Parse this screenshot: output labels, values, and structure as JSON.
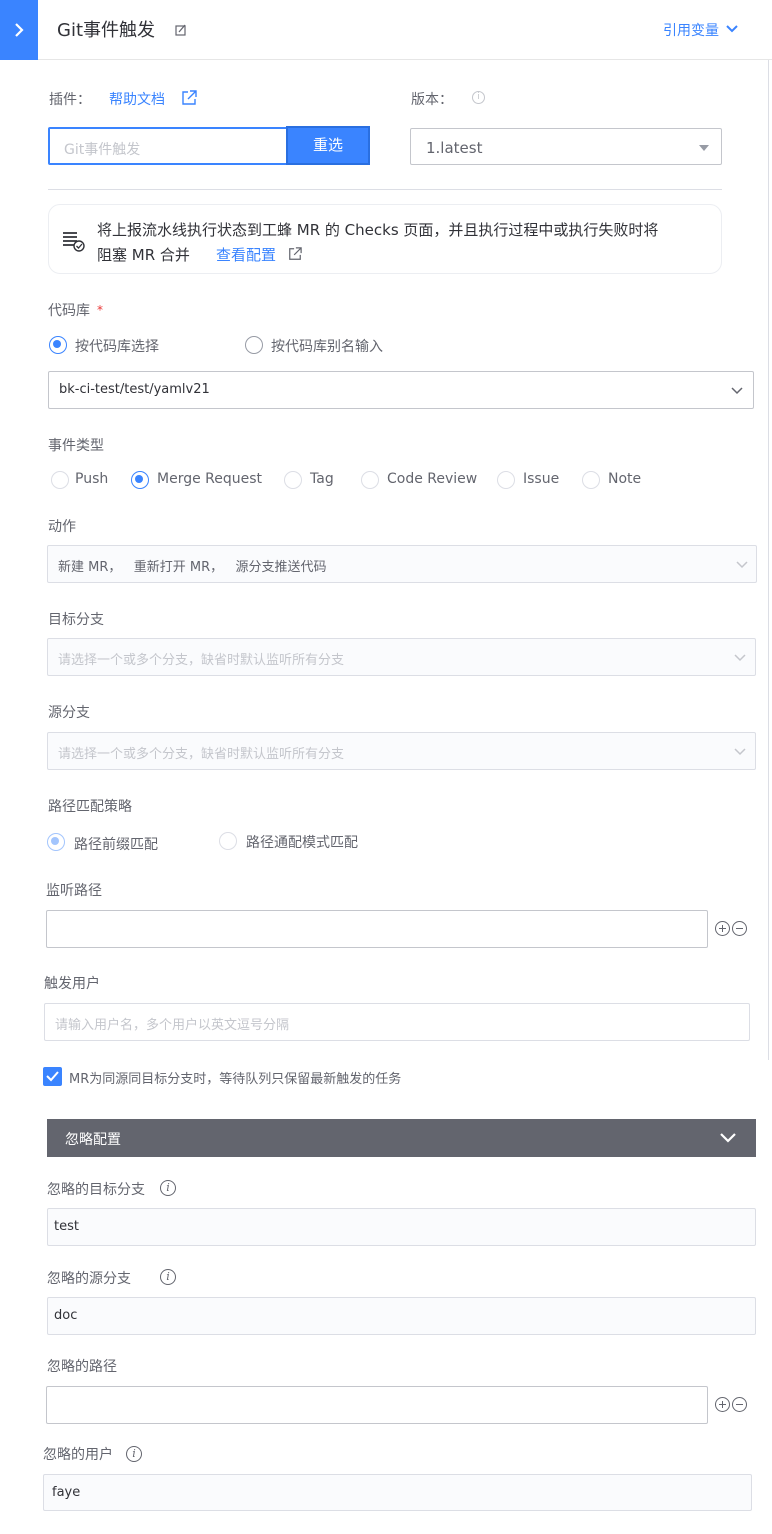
{
  "header": {
    "title": "Git事件触发",
    "ref_var": "引用变量"
  },
  "plugin": {
    "label": "插件：",
    "help_link": "帮助文档",
    "version_label": "版本：",
    "selected": "Git事件触发",
    "reselect": "重选",
    "version_value": "1.latest"
  },
  "notice": {
    "text_line1": "将上报流水线执行状态到工蜂 MR 的 Checks 页面，并且执行过程中或执行失败时将",
    "text_line2": "阻塞 MR 合并",
    "link": "查看配置"
  },
  "repo": {
    "label": "代码库",
    "required_mark": "*",
    "options": [
      "按代码库选择",
      "按代码库别名输入"
    ],
    "selected_index": 0,
    "value": "bk-ci-test/test/yamlv21"
  },
  "event_type": {
    "label": "事件类型",
    "options": [
      "Push",
      "Merge Request",
      "Tag",
      "Code Review",
      "Issue",
      "Note"
    ],
    "selected_index": 1
  },
  "action": {
    "label": "动作",
    "value": "新建 MR，   重新打开 MR，   源分支推送代码"
  },
  "target_branch": {
    "label": "目标分支",
    "placeholder": "请选择一个或多个分支，缺省时默认监听所有分支"
  },
  "source_branch": {
    "label": "源分支",
    "placeholder": "请选择一个或多个分支，缺省时默认监听所有分支"
  },
  "path_strategy": {
    "label": "路径匹配策略",
    "options": [
      "路径前缀匹配",
      "路径通配模式匹配"
    ],
    "selected_index": 0
  },
  "watch_path": {
    "label": "监听路径",
    "value": ""
  },
  "trigger_user": {
    "label": "触发用户",
    "placeholder": "请输入用户名，多个用户以英文逗号分隔"
  },
  "queue_checkbox": {
    "label": "MR为同源同目标分支时，等待队列只保留最新触发的任务",
    "checked": true
  },
  "ignore_section": {
    "title": "忽略配置",
    "target_branch_label": "忽略的目标分支",
    "target_branch_value": "test",
    "source_branch_label": "忽略的源分支",
    "source_branch_value": "doc",
    "path_label": "忽略的路径",
    "path_value": "",
    "user_label": "忽略的用户",
    "user_value": "faye"
  },
  "colors": {
    "accent": "#3a84ff",
    "section_bar": "#63656e",
    "required": "#ea3636"
  }
}
